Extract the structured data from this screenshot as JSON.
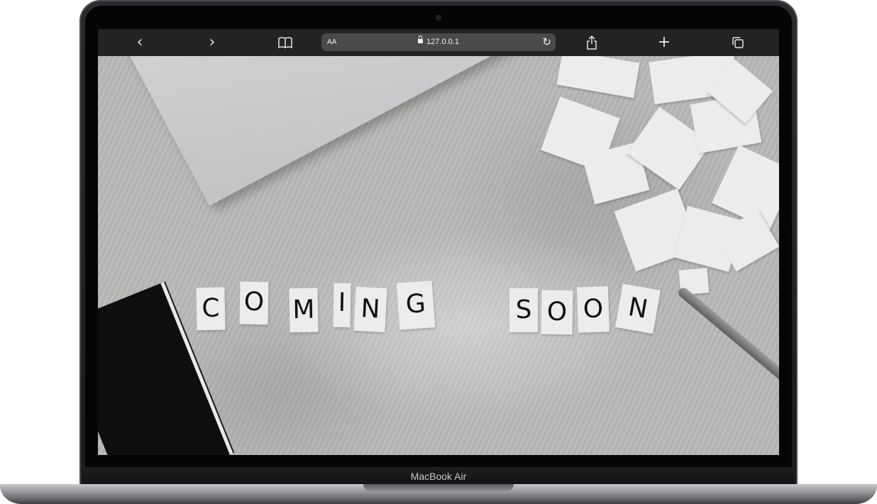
{
  "browser": {
    "back_icon": "chevron-left-icon",
    "forward_icon": "chevron-right-icon",
    "bookmarks_icon": "open-book-icon",
    "reader_label": "AA",
    "url": "127.0.0.1",
    "reload_icon": "reload-icon",
    "share_icon": "share-icon",
    "new_tab_icon": "plus-icon",
    "tabs_icon": "tabs-icon"
  },
  "hero": {
    "word1": [
      "C",
      "O",
      "M",
      "I",
      "N",
      "G"
    ],
    "word2": [
      "S",
      "O",
      "O",
      "N"
    ]
  },
  "device": {
    "label": "MacBook Air"
  }
}
